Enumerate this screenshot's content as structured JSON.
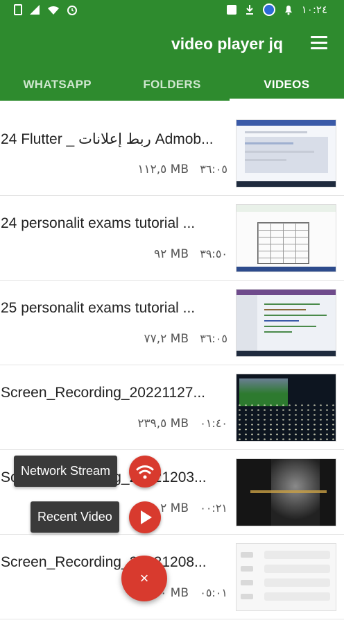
{
  "status_bar": {
    "time": "١٠:٢٤",
    "left_icons": [
      "battery-icon",
      "signal-icon",
      "wifi-icon",
      "alarm-icon"
    ],
    "right_icons": [
      "image-icon",
      "download-icon",
      "browser-icon",
      "notification-bell-icon"
    ]
  },
  "app_bar": {
    "title": "video player jq",
    "menu_icon": "menu-icon"
  },
  "tabs": [
    {
      "label": "WHATSAPP",
      "active": false
    },
    {
      "label": "FOLDERS",
      "active": false
    },
    {
      "label": "VIDEOS",
      "active": true
    }
  ],
  "videos": [
    {
      "title": "24 Flutter _ ربط إعلانات Admob...",
      "size": "١١٢,٥ MB",
      "duration": "٣٦:٠٥",
      "thumbnail": "screen-thumbnail"
    },
    {
      "title": "24 personalit exams tutorial ...",
      "size": "٩٢ MB",
      "duration": "٣٩:٥٠",
      "thumbnail": "spreadsheet-thumbnail"
    },
    {
      "title": "25 personalit exams tutorial ...",
      "size": "٧٧,٢ MB",
      "duration": "٣٦:٠٥",
      "thumbnail": "code-thumbnail"
    },
    {
      "title": "Screen_Recording_20221127...",
      "size": "٢٣٩,٥ MB",
      "duration": "٠١:٤٠",
      "thumbnail": "stadium-thumbnail"
    },
    {
      "title": "Screen_Recording_20221203...",
      "size": "٢ MB",
      "duration": "٠٠:٢١",
      "thumbnail": "dark-thumbnail"
    },
    {
      "title": "Screen_Recording_20221208...",
      "size": "٠ MB",
      "duration": "٠٥:٠١",
      "thumbnail": "chat-thumbnail"
    }
  ],
  "fab_menu": {
    "network_stream_label": "Network Stream",
    "recent_video_label": "Recent Video",
    "network_stream_icon": "wifi-icon",
    "recent_video_icon": "play-icon",
    "close_icon": "close-icon",
    "close_glyph": "×"
  },
  "colors": {
    "primary": "#2e8b2e",
    "fab": "#d83a2e",
    "tab_inactive": "#cfe7cf",
    "label_bg": "#3a3a3a"
  }
}
